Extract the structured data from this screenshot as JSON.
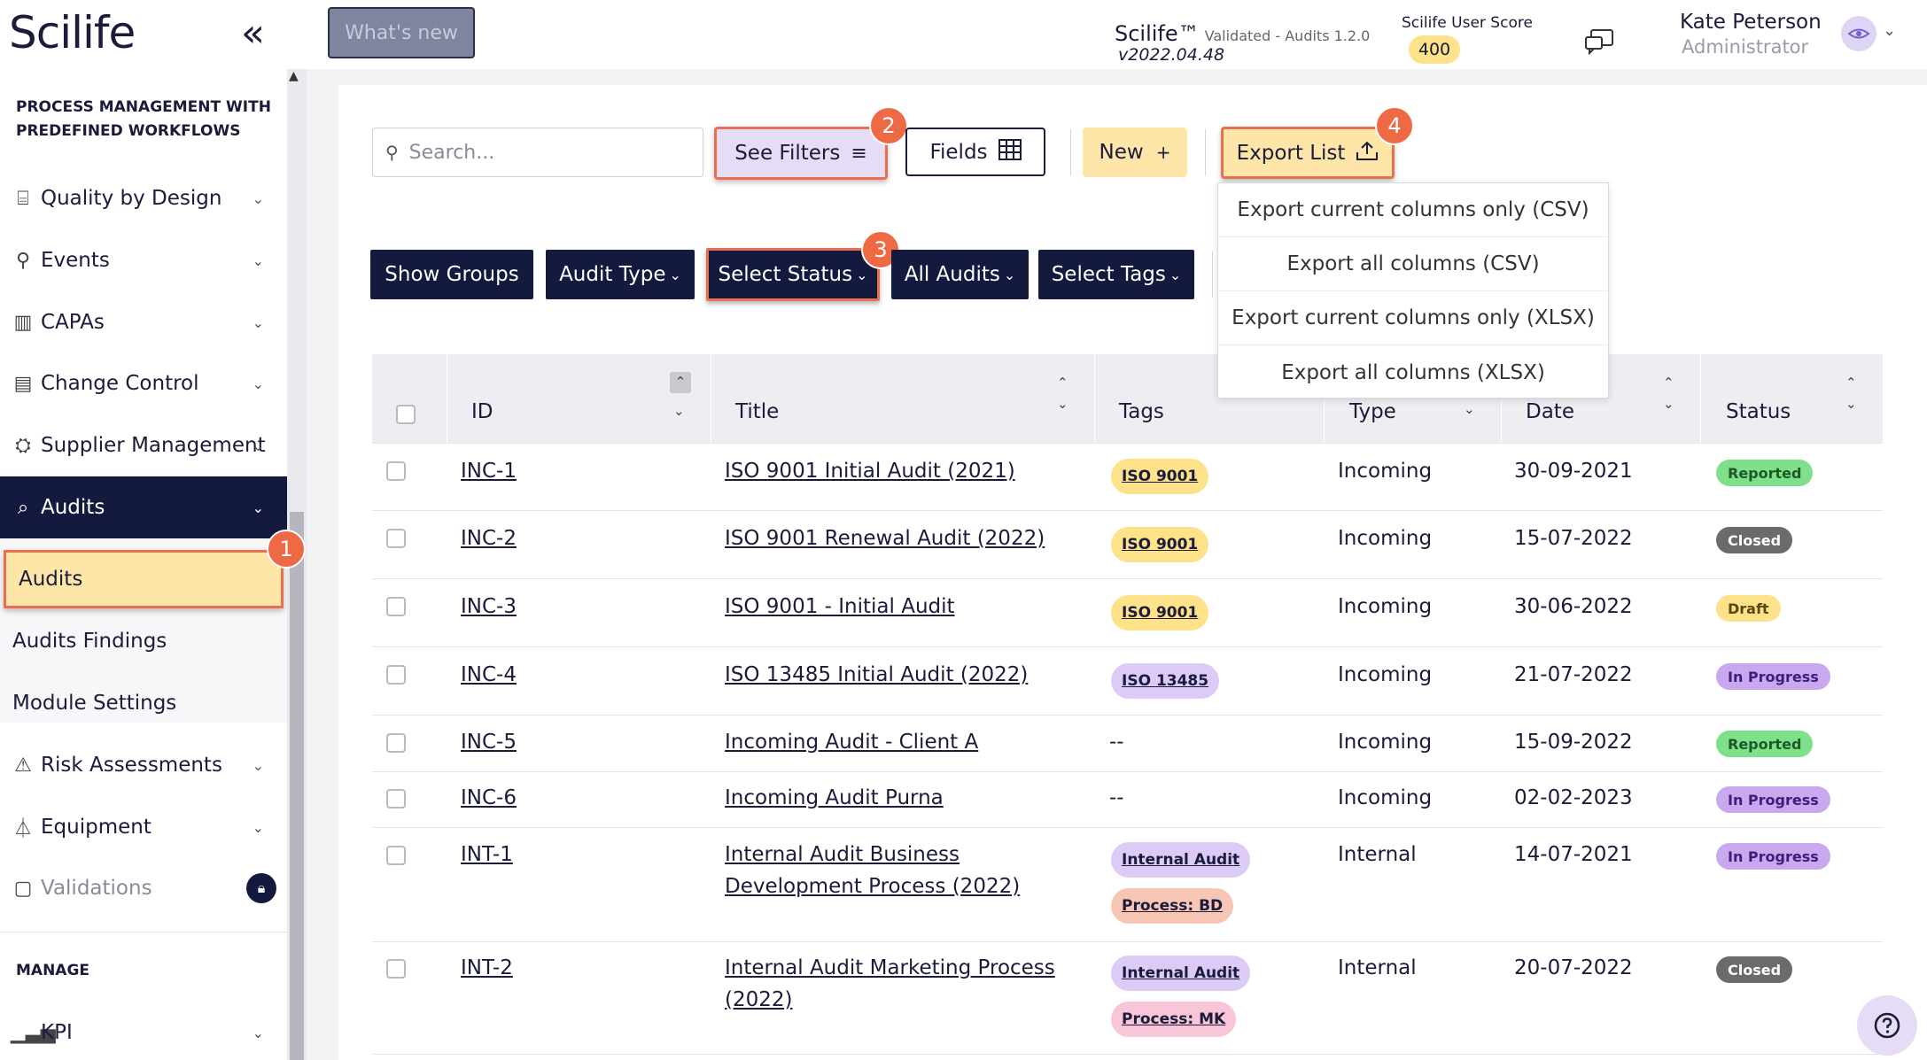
{
  "header": {
    "logo": "Scilife",
    "whats_new": "What's new",
    "product_name": "Scilife™",
    "product_sub": "Validated - Audits 1.2.0",
    "version": "v2022.04.48",
    "score_label": "Scilife User Score",
    "score_value": "400",
    "user_name": "Kate Peterson",
    "user_role": "Administrator"
  },
  "sidebar": {
    "section1": "PROCESS MANAGEMENT WITH PREDEFINED WORKFLOWS",
    "items": [
      {
        "label": "Quality by Design",
        "icon": "blueprint-icon"
      },
      {
        "label": "Events",
        "icon": "pin-icon"
      },
      {
        "label": "CAPAs",
        "icon": "capa-icon"
      },
      {
        "label": "Change Control",
        "icon": "change-icon"
      },
      {
        "label": "Supplier Management",
        "icon": "supplier-icon"
      },
      {
        "label": "Audits",
        "icon": "audit-icon"
      }
    ],
    "sub_items": [
      "Audits",
      "Audits Findings",
      "Module Settings"
    ],
    "items2": [
      {
        "label": "Risk Assessments",
        "icon": "warning-icon"
      },
      {
        "label": "Equipment",
        "icon": "flask-icon"
      },
      {
        "label": "Validations",
        "icon": "clipboard-icon"
      }
    ],
    "section2": "MANAGE",
    "kpi": "KPI"
  },
  "toolbar": {
    "search_placeholder": "Search...",
    "see_filters": "See Filters",
    "fields": "Fields",
    "new": "New",
    "export_list": "Export List"
  },
  "filters": {
    "show_groups": "Show Groups",
    "audit_type": "Audit Type",
    "select_status": "Select Status",
    "all_audits": "All Audits",
    "select_tags": "Select Tags"
  },
  "export_menu": [
    "Export current columns only (CSV)",
    "Export all columns (CSV)",
    "Export current columns only (XLSX)",
    "Export all columns (XLSX)"
  ],
  "steps": [
    "1",
    "2",
    "3",
    "4"
  ],
  "table": {
    "columns": [
      "ID",
      "Title",
      "Tags",
      "Type",
      "Date",
      "Status"
    ],
    "rows": [
      {
        "id": "INC-1",
        "title": "ISO 9001 Initial Audit (2021)",
        "title2": "",
        "tags": [
          "ISO 9001"
        ],
        "type": "Incoming",
        "date": "30-09-2021",
        "status": "Reported"
      },
      {
        "id": "INC-2",
        "title": "ISO 9001 Renewal Audit (2022)",
        "title2": "",
        "tags": [
          "ISO 9001"
        ],
        "type": "Incoming",
        "date": "15-07-2022",
        "status": "Closed"
      },
      {
        "id": "INC-3",
        "title": "ISO 9001 - Initial Audit",
        "title2": "",
        "tags": [
          "ISO 9001"
        ],
        "type": "Incoming",
        "date": "30-06-2022",
        "status": "Draft"
      },
      {
        "id": "INC-4",
        "title": "ISO 13485 Initial Audit (2022)",
        "title2": "",
        "tags": [
          "ISO 13485"
        ],
        "type": "Incoming",
        "date": "21-07-2022",
        "status": "In Progress"
      },
      {
        "id": "INC-5",
        "title": "Incoming Audit - Client A",
        "title2": "",
        "tags": [],
        "empty_tag": "--",
        "type": "Incoming",
        "date": "15-09-2022",
        "status": "Reported"
      },
      {
        "id": "INC-6",
        "title": "Incoming Audit Purna",
        "title2": "",
        "tags": [],
        "empty_tag": "--",
        "type": "Incoming",
        "date": "02-02-2023",
        "status": "In Progress"
      },
      {
        "id": "INT-1",
        "title": "Internal Audit Business",
        "title2": "Development Process (2022)",
        "tags": [
          "Internal Audit",
          "Process: BD"
        ],
        "type": "Internal",
        "date": "14-07-2021",
        "status": "In Progress"
      },
      {
        "id": "INT-2",
        "title": "Internal Audit Marketing Process",
        "title2": "(2022)",
        "tags": [
          "Internal Audit",
          "Process: MK"
        ],
        "type": "Internal",
        "date": "20-07-2022",
        "status": "Closed"
      }
    ]
  },
  "colors": {
    "navy": "#141a3e",
    "highlight": "#e87050",
    "yellow": "#fde6a8",
    "lavender": "#e6dcf6",
    "reported": "#7ee08a",
    "closed": "#6b6b6b",
    "draft": "#fde28a",
    "in_progress": "#c9a8f0"
  }
}
